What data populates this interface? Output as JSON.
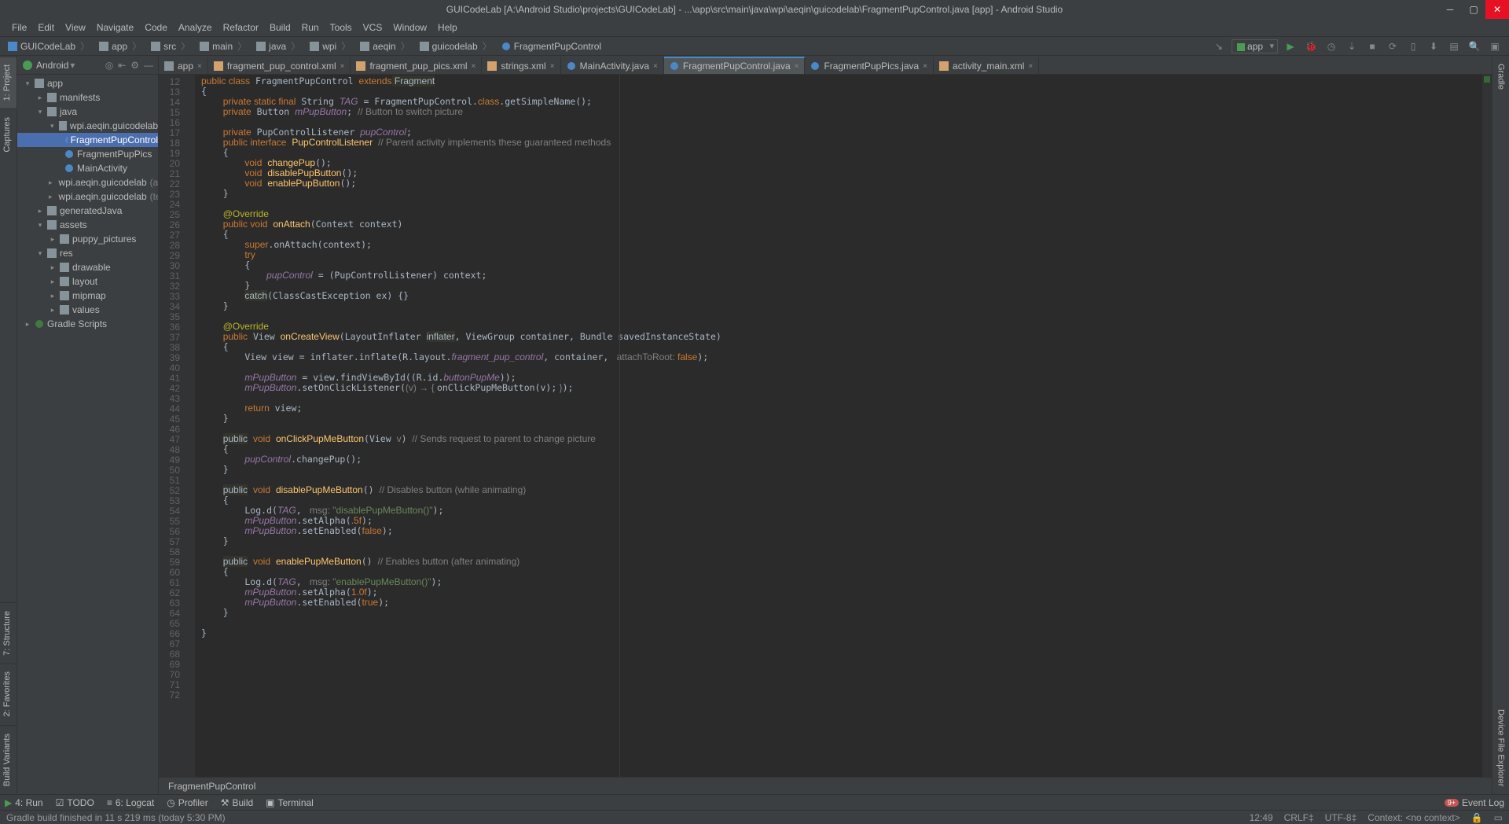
{
  "title": "GUICodeLab [A:\\Android Studio\\projects\\GUICodeLab] - ...\\app\\src\\main\\java\\wpi\\aeqin\\guicodelab\\FragmentPupControl.java [app] - Android Studio",
  "menu": [
    "File",
    "Edit",
    "View",
    "Navigate",
    "Code",
    "Analyze",
    "Refactor",
    "Build",
    "Run",
    "Tools",
    "VCS",
    "Window",
    "Help"
  ],
  "breadcrumbs": [
    "GUICodeLab",
    "app",
    "src",
    "main",
    "java",
    "wpi",
    "aeqin",
    "guicodelab",
    "FragmentPupControl"
  ],
  "run_config": "app",
  "project_panel": {
    "title": "Android"
  },
  "tree": {
    "root": "app",
    "manifests": "manifests",
    "java": "java",
    "pkg_main": "wpi.aeqin.guicodelab",
    "classes": [
      "FragmentPupControl",
      "FragmentPupPics",
      "MainActivity"
    ],
    "pkg_android": "wpi.aeqin.guicodelab",
    "pkg_android_suffix": "(androidTest)",
    "pkg_test": "wpi.aeqin.guicodelab",
    "pkg_test_suffix": "(test)",
    "generated": "generatedJava",
    "assets": "assets",
    "puppy": "puppy_pictures",
    "res": "res",
    "res_children": [
      "drawable",
      "layout",
      "mipmap",
      "values"
    ],
    "gradle": "Gradle Scripts"
  },
  "tabs": [
    {
      "label": "app",
      "icon": "module",
      "active": false
    },
    {
      "label": "fragment_pup_control.xml",
      "icon": "xml",
      "active": false
    },
    {
      "label": "fragment_pup_pics.xml",
      "icon": "xml",
      "active": false
    },
    {
      "label": "strings.xml",
      "icon": "xml",
      "active": false
    },
    {
      "label": "MainActivity.java",
      "icon": "class",
      "active": false
    },
    {
      "label": "FragmentPupControl.java",
      "icon": "class",
      "active": true
    },
    {
      "label": "FragmentPupPics.java",
      "icon": "class",
      "active": false
    },
    {
      "label": "activity_main.xml",
      "icon": "xml",
      "active": false
    }
  ],
  "line_start": 12,
  "line_end": 72,
  "breadcrumb_bottom": "FragmentPupControl",
  "bottom_tabs": {
    "run": "4: Run",
    "todo": "TODO",
    "logcat": "6: Logcat",
    "profiler": "Profiler",
    "build": "Build",
    "terminal": "Terminal",
    "eventlog": "Event Log"
  },
  "status_left": "Gradle build finished in 11 s 219 ms (today 5:30 PM)",
  "status_right": {
    "pos": "12:49",
    "sep": "CRLF‡",
    "enc": "UTF-8‡",
    "ctx": "Context: <no context>"
  },
  "left_gutter": [
    "1: Project",
    "Captures"
  ],
  "left_gutter_bottom": [
    "Build Variants",
    "2: Favorites",
    "7: Structure"
  ],
  "right_gutter": [
    "Gradle"
  ],
  "right_gutter_bottom": [
    "Device File Explorer"
  ],
  "code": {
    "l12": [
      "public class",
      " FragmentPupControl ",
      "extends",
      {
        "hl": " Fragment"
      }
    ],
    "l13": "{",
    "l14": [
      "    ",
      "private static final",
      " String ",
      {
        "fld": "TAG"
      },
      " = FragmentPupControl.",
      "class",
      ".getSimpleName();"
    ],
    "l15": [
      "    ",
      "private",
      " Button ",
      {
        "fld": "mPupButton"
      },
      "; ",
      {
        "c": "// Button to switch picture"
      }
    ],
    "l16": "",
    "l17": [
      "    ",
      "private",
      " PupControlListener ",
      {
        "fld": "pupControl"
      },
      ";"
    ],
    "l18": [
      "    ",
      "public interface",
      " ",
      {
        "fn": "PupControlListener"
      },
      " ",
      {
        "c": "// Parent activity implements these guaranteed methods"
      }
    ],
    "l19": "    {",
    "l20": [
      "        ",
      "void",
      " ",
      {
        "fn": "changePup"
      },
      "();"
    ],
    "l21": [
      "        ",
      "void",
      " ",
      {
        "fn": "disablePupButton"
      },
      "();"
    ],
    "l22": [
      "        ",
      "void",
      " ",
      {
        "fn": "enablePupButton"
      },
      "();"
    ],
    "l23": "    }",
    "l24": "",
    "l25": [
      "    ",
      {
        "an": "@Override"
      }
    ],
    "l26": [
      "    ",
      "public void",
      " ",
      {
        "fn": "onAttach"
      },
      "(Context context)"
    ],
    "l27": "    {",
    "l28": [
      "        ",
      "super",
      ".onAttach(context);"
    ],
    "l29": [
      "        ",
      "try"
    ],
    "l30": "        {",
    "l31": [
      "            ",
      {
        "fld": "pupControl"
      },
      " = (PupControlListener) context;"
    ],
    "l32": "        }",
    "l33": [
      "        ",
      {
        "hl": "catch"
      },
      "(ClassCastException ex) {}"
    ],
    "l34": "    }",
    "l35": "",
    "l36": [
      "    ",
      {
        "an": "@Override"
      }
    ],
    "l37": [
      "    ",
      "public",
      " View ",
      {
        "fn": "onCreateView"
      },
      "(LayoutInflater ",
      {
        "hl": "inflater"
      },
      ", ViewGroup container, Bundle savedInstanceState)"
    ],
    "l38": "    {",
    "l39": [
      "        View view = inflater.inflate(R.layout.",
      {
        "fld": "fragment_pup_control"
      },
      ", container, ",
      {
        "dim": " attachToRoot: "
      },
      "false",
      ");"
    ],
    "l40": "",
    "l41": [
      "        ",
      {
        "fld": "mPupButton"
      },
      " = view.findViewById((R.id.",
      {
        "fld": "buttonPupMe"
      },
      "));"
    ],
    "l42": [
      "        ",
      {
        "fld": "mPupButton"
      },
      ".setOnClickListener(",
      {
        "dim": "(v) → { "
      },
      "onClickPupMeButton(v);",
      {
        "dim": " }"
      },
      ");"
    ],
    "l43": "",
    "l44": [
      "        ",
      "return",
      " view;"
    ],
    "l45": "    }",
    "l46": "",
    "l47": [
      "    ",
      {
        "hl": "public"
      },
      " ",
      "void",
      " ",
      {
        "fn": "onClickPupMeButton"
      },
      "(View ",
      {
        "dim": "v"
      },
      ") ",
      {
        "c": "// Sends request to parent to change picture"
      }
    ],
    "l48": "    {",
    "l49": [
      "        ",
      {
        "fld": "pupControl"
      },
      ".changePup();"
    ],
    "l50": "    }",
    "l51": "",
    "l52": [
      "    ",
      {
        "hl": "public"
      },
      " ",
      "void",
      " ",
      {
        "fn": "disablePupMeButton"
      },
      "() ",
      {
        "c": "// Disables button (while animating)"
      }
    ],
    "l53": "    {",
    "l54": [
      "        Log.d(",
      {
        "fld": "TAG"
      },
      ", ",
      {
        "dim": " msg: "
      },
      {
        "s": "\"disablePupMeButton()\""
      },
      ");"
    ],
    "l55": [
      "        ",
      {
        "fld": "mPupButton"
      },
      ".setAlpha(",
      ".5f",
      ");"
    ],
    "l56": [
      "        ",
      {
        "fld": "mPupButton"
      },
      ".setEnabled(",
      "false",
      ");"
    ],
    "l57": "    }",
    "l58": "",
    "l59": [
      "    ",
      {
        "hl": "public"
      },
      " ",
      "void",
      " ",
      {
        "fn": "enablePupMeButton"
      },
      "() ",
      {
        "c": "// Enables button (after animating)"
      }
    ],
    "l60": "    {",
    "l61": [
      "        Log.d(",
      {
        "fld": "TAG"
      },
      ", ",
      {
        "dim": " msg: "
      },
      {
        "s": "\"enablePupMeButton()\""
      },
      ");"
    ],
    "l62": [
      "        ",
      {
        "fld": "mPupButton"
      },
      ".setAlpha(",
      "1.0f",
      ");"
    ],
    "l63": [
      "        ",
      {
        "fld": "mPupButton"
      },
      ".setEnabled(",
      "true",
      ");"
    ],
    "l64": "    }",
    "l65": "",
    "l66": "}"
  }
}
